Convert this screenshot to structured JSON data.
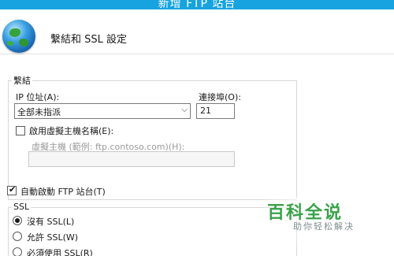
{
  "window": {
    "title": "新增 FTP 站台"
  },
  "header": {
    "title": "繫結和 SSL 設定",
    "icon": "globe-icon"
  },
  "binding": {
    "group_label": "繫結",
    "ip_label": "IP 位址(A):",
    "ip_value": "全部未指派",
    "port_label": "連接埠(O):",
    "port_value": "21",
    "virtual_host_checkbox_label": "啟用虛擬主機名稱(E):",
    "virtual_host_checked": false,
    "virtual_host_field_label": "虛擬主機 (範例: ftp.contoso.com)(H):",
    "virtual_host_value": ""
  },
  "autostart": {
    "label": "自動啟動 FTP 站台(T)",
    "checked": true
  },
  "ssl": {
    "group_label": "SSL",
    "options": [
      "沒有 SSL(L)",
      "允許 SSL(W)",
      "必須使用 SSL(R)"
    ],
    "selected_index": 0
  },
  "watermark": {
    "main": "百科全说",
    "sub": "助你轻松解决"
  },
  "colors": {
    "titlebar": "#17a3e0",
    "watermark_green": "#3aa24a"
  }
}
